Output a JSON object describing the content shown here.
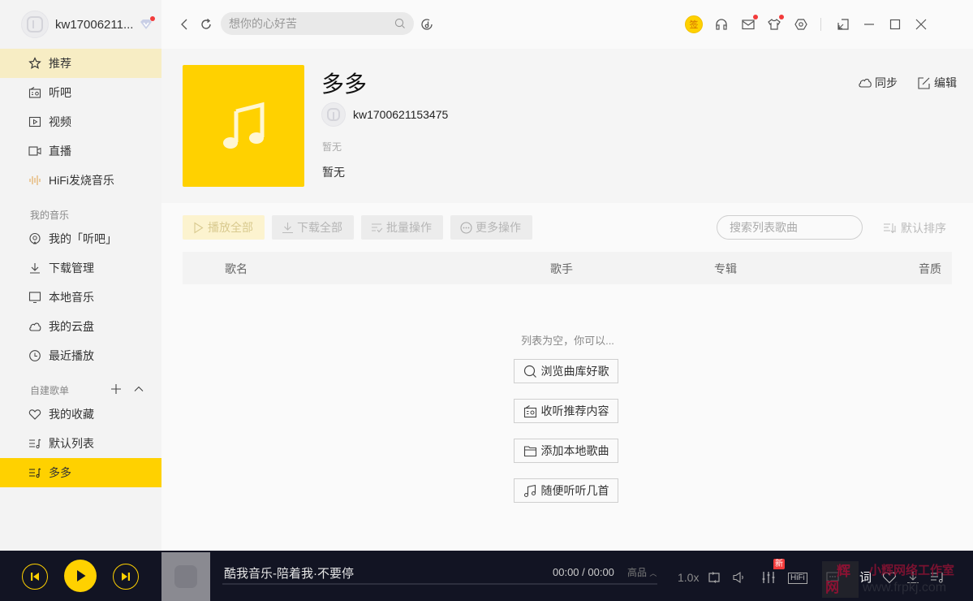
{
  "user": {
    "name": "kw17006211...",
    "vip_icon": "vip-diamond-icon",
    "has_notification": true
  },
  "topbar": {
    "search_placeholder": "想你的心好苦",
    "sign_label": "签",
    "icons": [
      "back-icon",
      "refresh-icon",
      "search-icon",
      "music-recognize-icon",
      "sign-in-icon",
      "headphones-icon",
      "mail-icon",
      "skin-icon",
      "settings-icon",
      "mini-mode-icon",
      "minimize-icon",
      "maximize-icon",
      "close-icon"
    ]
  },
  "sidebar": {
    "main_items": [
      {
        "label": "推荐",
        "icon": "star-icon",
        "active": true
      },
      {
        "label": "听吧",
        "icon": "radio-icon"
      },
      {
        "label": "视频",
        "icon": "video-icon"
      },
      {
        "label": "直播",
        "icon": "live-camera-icon"
      },
      {
        "label": "HiFi发烧音乐",
        "icon": "soundwave-icon"
      }
    ],
    "my_music_title": "我的音乐",
    "my_music_items": [
      {
        "label": "我的「听吧」",
        "icon": "podcast-icon"
      },
      {
        "label": "下载管理",
        "icon": "download-icon"
      },
      {
        "label": "本地音乐",
        "icon": "monitor-icon"
      },
      {
        "label": "我的云盘",
        "icon": "cloud-icon"
      },
      {
        "label": "最近播放",
        "icon": "clock-icon"
      }
    ],
    "playlists_title": "自建歌单",
    "playlist_items": [
      {
        "label": "我的收藏",
        "icon": "heart-icon"
      },
      {
        "label": "默认列表",
        "icon": "playlist-icon"
      },
      {
        "label": "多多",
        "icon": "playlist-icon",
        "selected": true
      }
    ]
  },
  "playlist": {
    "title": "多多",
    "creator": "kw1700621153475",
    "tags": "暂无",
    "description": "暂无",
    "sync_label": "同步",
    "edit_label": "编辑"
  },
  "toolbar": {
    "play_all": "播放全部",
    "download_all": "下载全部",
    "batch": "批量操作",
    "more": "更多操作",
    "search_placeholder": "搜索列表歌曲",
    "sort": "默认排序"
  },
  "table": {
    "columns": [
      "歌名",
      "歌手",
      "专辑",
      "音质"
    ]
  },
  "empty": {
    "message": "列表为空，你可以...",
    "actions": [
      {
        "label": "浏览曲库好歌",
        "icon": "search-icon"
      },
      {
        "label": "收听推荐内容",
        "icon": "radio-icon"
      },
      {
        "label": "添加本地歌曲",
        "icon": "folder-icon"
      },
      {
        "label": "随便听听几首",
        "icon": "music-note-icon"
      }
    ]
  },
  "player": {
    "song": "酷我音乐-陪着我·不要停",
    "time": "00:00 / 00:00",
    "quality": "高品",
    "speed": "1.0x",
    "new_badge": "新",
    "hifi": "HiFi",
    "lyric": "词",
    "progress": 0
  },
  "watermark": {
    "logo_line1": "辉",
    "logo_line2": "网",
    "name": "小辉网络工作室",
    "url": "www.frpkj.com"
  },
  "colors": {
    "accent": "#ffd100",
    "player_bg": "#121423",
    "badge_red": "#f23b3b"
  }
}
